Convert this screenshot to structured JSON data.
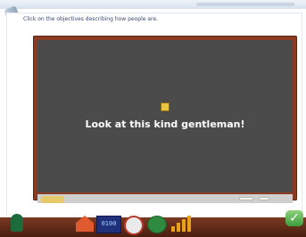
{
  "instruction": "Click on the objectives describing how people are.",
  "board_text": "Look at this kind gentleman!",
  "toolbar": {
    "counter_text": "0100"
  },
  "check_button": "✓"
}
